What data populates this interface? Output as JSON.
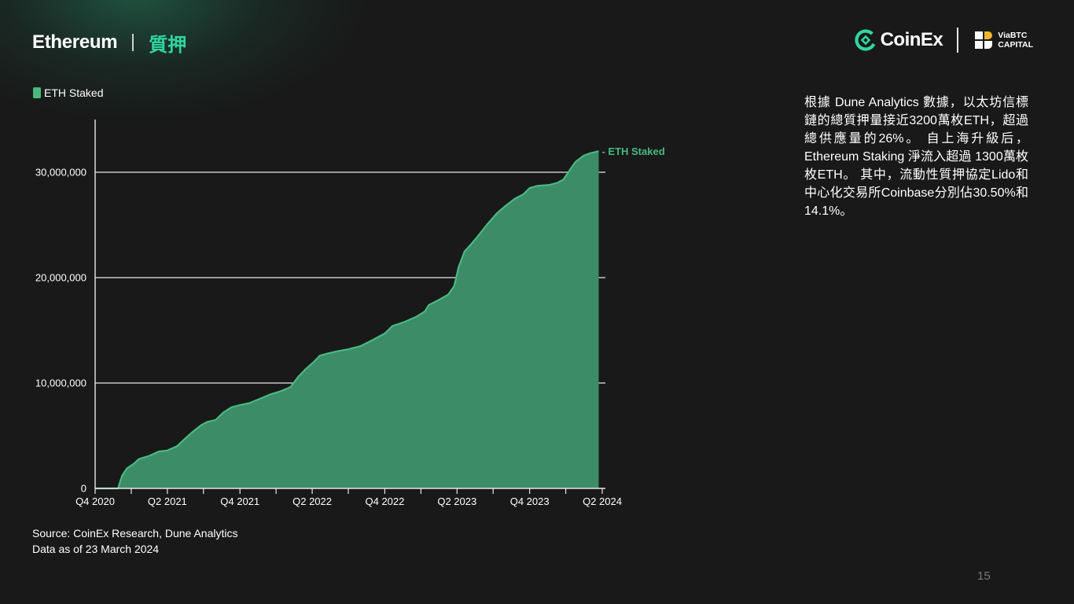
{
  "header": {
    "title_en": "Ethereum",
    "title_zh": "質押"
  },
  "logos": {
    "coinex": "CoinEx",
    "viabtc_line1": "ViaBTC",
    "viabtc_line2": "CAPITAL",
    "coinex_icon": "coinex-logo-icon",
    "viabtc_icon": "viabtc-logo-icon"
  },
  "colors": {
    "background": "#191919",
    "accent": "#2fd6a0",
    "area_fill": "#3c8c68",
    "area_line": "#49b982"
  },
  "chart_data": {
    "type": "area",
    "legend": [
      "ETH Staked"
    ],
    "legend_position": "top-left",
    "series": [
      {
        "name": "ETH Staked",
        "end_label": "ETH Staked",
        "points": [
          [
            "2020-10-01",
            0
          ],
          [
            "2020-11-28",
            0
          ],
          [
            "2020-12-01",
            400000
          ],
          [
            "2020-12-08",
            1200000
          ],
          [
            "2020-12-20",
            1900000
          ],
          [
            "2021-01-05",
            2300000
          ],
          [
            "2021-01-20",
            2800000
          ],
          [
            "2021-02-15",
            3100000
          ],
          [
            "2021-03-10",
            3500000
          ],
          [
            "2021-04-01",
            3600000
          ],
          [
            "2021-04-25",
            4000000
          ],
          [
            "2021-05-15",
            4700000
          ],
          [
            "2021-06-05",
            5400000
          ],
          [
            "2021-06-25",
            6000000
          ],
          [
            "2021-07-10",
            6300000
          ],
          [
            "2021-08-01",
            6500000
          ],
          [
            "2021-08-20",
            7200000
          ],
          [
            "2021-09-10",
            7700000
          ],
          [
            "2021-10-01",
            7900000
          ],
          [
            "2021-10-25",
            8100000
          ],
          [
            "2021-11-20",
            8500000
          ],
          [
            "2021-12-15",
            8900000
          ],
          [
            "2022-01-10",
            9200000
          ],
          [
            "2022-02-05",
            9600000
          ],
          [
            "2022-02-25",
            10600000
          ],
          [
            "2022-03-15",
            11300000
          ],
          [
            "2022-04-05",
            12000000
          ],
          [
            "2022-04-20",
            12600000
          ],
          [
            "2022-05-10",
            12800000
          ],
          [
            "2022-06-01",
            13000000
          ],
          [
            "2022-07-01",
            13200000
          ],
          [
            "2022-08-01",
            13500000
          ],
          [
            "2022-09-01",
            14100000
          ],
          [
            "2022-10-01",
            14700000
          ],
          [
            "2022-10-20",
            15400000
          ],
          [
            "2022-11-20",
            15800000
          ],
          [
            "2022-12-20",
            16300000
          ],
          [
            "2023-01-10",
            16800000
          ],
          [
            "2023-01-20",
            17400000
          ],
          [
            "2023-02-15",
            17900000
          ],
          [
            "2023-03-10",
            18400000
          ],
          [
            "2023-03-25",
            19200000
          ],
          [
            "2023-04-05",
            21000000
          ],
          [
            "2023-04-20",
            22500000
          ],
          [
            "2023-05-05",
            23100000
          ],
          [
            "2023-05-25",
            24000000
          ],
          [
            "2023-06-15",
            25000000
          ],
          [
            "2023-07-10",
            26100000
          ],
          [
            "2023-08-01",
            26800000
          ],
          [
            "2023-08-25",
            27500000
          ],
          [
            "2023-09-15",
            27900000
          ],
          [
            "2023-10-01",
            28500000
          ],
          [
            "2023-10-20",
            28700000
          ],
          [
            "2023-11-20",
            28800000
          ],
          [
            "2023-12-10",
            29000000
          ],
          [
            "2023-12-25",
            29300000
          ],
          [
            "2024-01-10",
            30200000
          ],
          [
            "2024-01-25",
            31000000
          ],
          [
            "2024-02-15",
            31600000
          ],
          [
            "2024-03-01",
            31800000
          ],
          [
            "2024-03-23",
            32000000
          ]
        ]
      }
    ],
    "x_ticks": [
      "Q4 2020",
      "Q2 2021",
      "Q4 2021",
      "Q2 2022",
      "Q4 2022",
      "Q2 2023",
      "Q4 2023",
      "Q2 2024"
    ],
    "x_tick_dates": [
      "2020-10-01",
      "2021-04-01",
      "2021-10-01",
      "2022-04-01",
      "2022-10-01",
      "2023-04-01",
      "2023-10-01",
      "2024-04-01"
    ],
    "y_ticks": [
      0,
      10000000,
      20000000,
      30000000
    ],
    "y_tick_labels": [
      "0",
      "10,000,000",
      "20,000,000",
      "30,000,000"
    ],
    "ylim": [
      0,
      35000000
    ],
    "xlim": [
      "2020-10-01",
      "2024-04-01"
    ],
    "grid": "horizontal",
    "xlabel": "",
    "ylabel": "",
    "title": ""
  },
  "description": "根據 Dune Analytics 數據，以太坊信標鏈的總質押量接近3200萬枚ETH，超過總供應量的26%。 自上海升級后，Ethereum Staking 淨流入超過 1300萬枚枚ETH。 其中，流動性質押協定Lido和中心化交易所Coinbase分別佔30.50%和14.1%。",
  "source": {
    "line1": "Source: CoinEx Research, Dune Analytics",
    "line2": "Data as of 23 March 2024"
  },
  "page_number": "15"
}
